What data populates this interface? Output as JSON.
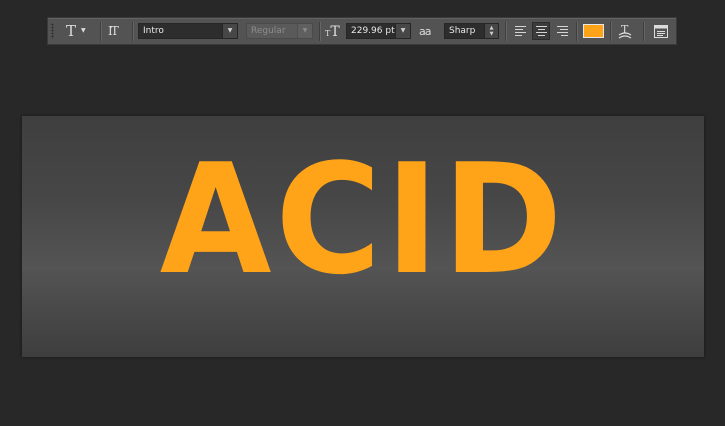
{
  "toolbar": {
    "text_tool_icon": "T",
    "orientation_icon": "IT",
    "font_family": {
      "value": "Intro"
    },
    "font_style": {
      "value": "Regular"
    },
    "font_size_icon": "T",
    "font_size": {
      "value": "229.96 pt"
    },
    "antialias_icon": "aa",
    "antialias": {
      "value": "Sharp"
    },
    "alignment": [
      "left",
      "center",
      "right"
    ],
    "active_alignment": "center",
    "text_color": "#ffa418"
  },
  "canvas": {
    "text": "ACID",
    "text_color": "#ffa418"
  }
}
